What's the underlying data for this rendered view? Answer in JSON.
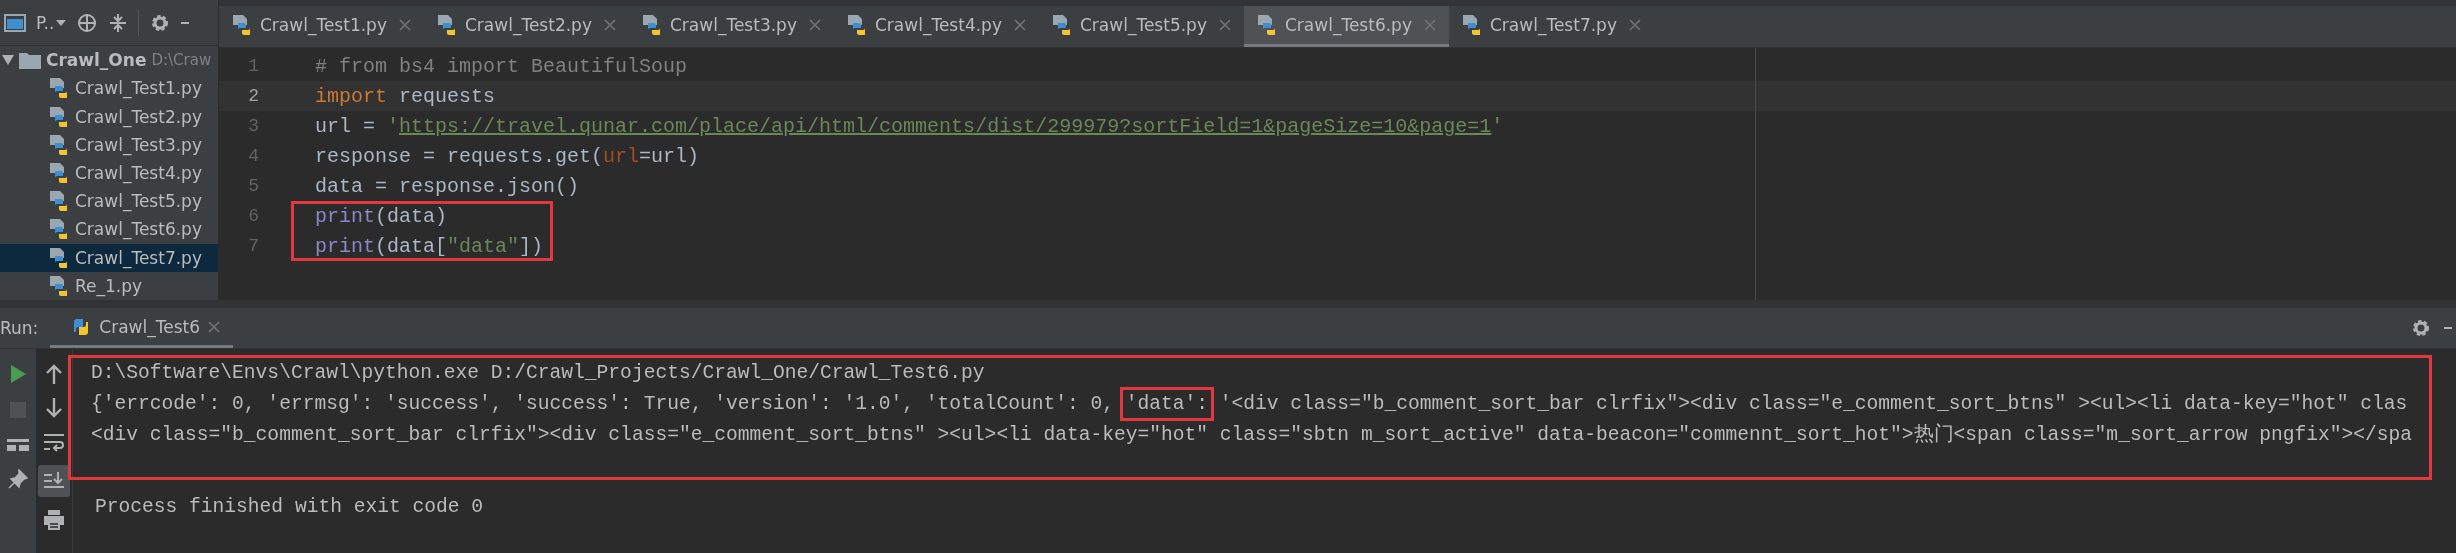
{
  "project_panel": {
    "title": "P..",
    "root": {
      "name": "Crawl_One",
      "path": "D:\\Craw",
      "expanded": true
    },
    "files": [
      {
        "label": "Crawl_Test1.py",
        "selected": false
      },
      {
        "label": "Crawl_Test2.py",
        "selected": false
      },
      {
        "label": "Crawl_Test3.py",
        "selected": false
      },
      {
        "label": "Crawl_Test4.py",
        "selected": false
      },
      {
        "label": "Crawl_Test5.py",
        "selected": false
      },
      {
        "label": "Crawl_Test6.py",
        "selected": false
      },
      {
        "label": "Crawl_Test7.py",
        "selected": true
      },
      {
        "label": "Re_1.py",
        "selected": false
      }
    ]
  },
  "tabs": [
    {
      "label": "Crawl_Test1.py",
      "selected": false
    },
    {
      "label": "Crawl_Test2.py",
      "selected": false
    },
    {
      "label": "Crawl_Test3.py",
      "selected": false
    },
    {
      "label": "Crawl_Test4.py",
      "selected": false
    },
    {
      "label": "Crawl_Test5.py",
      "selected": false
    },
    {
      "label": "Crawl_Test6.py",
      "selected": true
    },
    {
      "label": "Crawl_Test7.py",
      "selected": false
    }
  ],
  "editor": {
    "lines": [
      {
        "number": "1",
        "current": false,
        "boxed": false,
        "tokens": [
          {
            "kind": "comment",
            "text": "# from bs4 import BeautifulSoup"
          }
        ]
      },
      {
        "number": "2",
        "current": true,
        "boxed": false,
        "tokens": [
          {
            "kind": "keyword",
            "text": "import"
          },
          {
            "kind": "plain",
            "text": " requests"
          }
        ]
      },
      {
        "number": "3",
        "current": false,
        "boxed": false,
        "tokens": [
          {
            "kind": "plain",
            "text": "url = "
          },
          {
            "kind": "string",
            "text": "'"
          },
          {
            "kind": "link",
            "text": "https://travel.qunar.com/place/api/html/comments/dist/299979?sortField=1&pageSize=10&page=1"
          },
          {
            "kind": "string",
            "text": "'"
          }
        ]
      },
      {
        "number": "4",
        "current": false,
        "boxed": false,
        "tokens": [
          {
            "kind": "plain",
            "text": "response = requests.get("
          },
          {
            "kind": "param",
            "text": "url"
          },
          {
            "kind": "plain",
            "text": "=url)"
          }
        ]
      },
      {
        "number": "5",
        "current": false,
        "boxed": false,
        "tokens": [
          {
            "kind": "plain",
            "text": "data = response.json()"
          }
        ]
      },
      {
        "number": "6",
        "current": false,
        "boxed": true,
        "tokens": [
          {
            "kind": "builtin",
            "text": "print"
          },
          {
            "kind": "plain",
            "text": "(data)"
          }
        ]
      },
      {
        "number": "7",
        "current": false,
        "boxed": true,
        "tokens": [
          {
            "kind": "builtin",
            "text": "print"
          },
          {
            "kind": "plain",
            "text": "(data["
          },
          {
            "kind": "string",
            "text": "\"data\""
          },
          {
            "kind": "plain",
            "text": "])"
          }
        ]
      }
    ]
  },
  "run": {
    "label": "Run:",
    "tabs": [
      {
        "label": "Crawl_Test6",
        "selected": true
      }
    ],
    "autoscroll_on": true,
    "output": [
      {
        "boxed": true,
        "segments": [
          {
            "text": "D:\\Software\\Envs\\Crawl\\python.exe D:/Crawl_Projects/Crawl_One/Crawl_Test6.py"
          }
        ]
      },
      {
        "boxed": true,
        "segments": [
          {
            "text": "{'errcode': 0, 'errmsg': 'success', 'success': True, 'version': '1.0', 'totalCount': 0, "
          },
          {
            "text": "'data':",
            "boxed": true
          },
          {
            "text": " '<div class=\"b_comment_sort_bar clrfix\"><div class=\"e_comment_sort_btns\" ><ul><li data-key=\"hot\" clas"
          }
        ]
      },
      {
        "boxed": true,
        "segments": [
          {
            "text": "<div class=\"b_comment_sort_bar clrfix\"><div class=\"e_comment_sort_btns\" ><ul><li data-key=\"hot\" class=\"sbtn m_sort_active\" data-beacon=\"commennt_sort_hot\">热门<span class=\"m_sort_arrow pngfix\"></spa"
          }
        ]
      },
      {
        "boxed": false,
        "segments": [
          {
            "text": "Process finished with exit code 0"
          }
        ]
      }
    ]
  }
}
